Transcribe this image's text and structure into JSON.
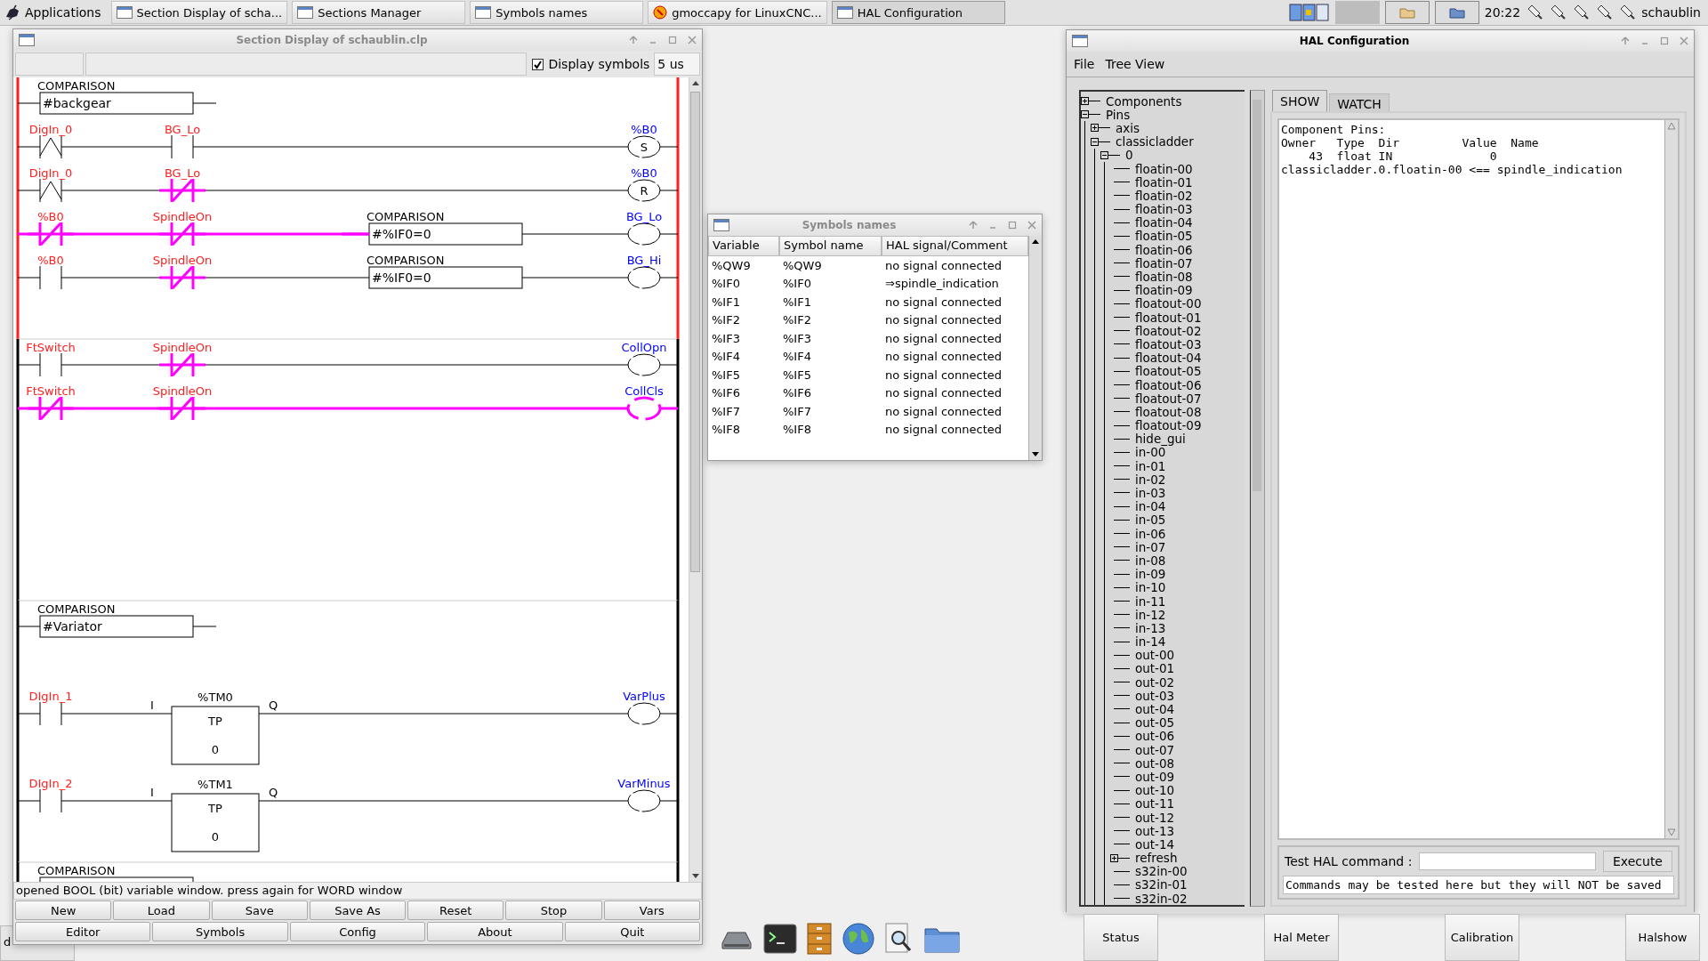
{
  "panel": {
    "menu_label": "Applications",
    "tasks": [
      {
        "label": "Section Display of scha...",
        "kind": "window",
        "selected": false
      },
      {
        "label": "Sections Manager",
        "kind": "window",
        "selected": false
      },
      {
        "label": "Symbols names",
        "kind": "window",
        "selected": false
      },
      {
        "label": "gmoccapy for LinuxCNC...",
        "kind": "app",
        "selected": false
      },
      {
        "label": "HAL Configuration",
        "kind": "window",
        "selected": true
      }
    ],
    "clock": "20:22",
    "user": "schaublin"
  },
  "section_window": {
    "title": "Section Display of schaublin.clp",
    "active": false,
    "display_symbols": {
      "label": "Display symbols",
      "checked": true
    },
    "period": "5 us",
    "blocks": [
      {
        "selected": true,
        "rows": [
          {
            "kind": "comparison",
            "label": "COMPARISON",
            "expression": "#backgear"
          },
          {
            "kind": "rung",
            "elements": [
              {
                "kind": "edge_contact",
                "label": "DigIn_0",
                "active": false
              },
              {
                "kind": "open_contact",
                "label": "BG_Lo",
                "active": false
              },
              {
                "kind": "coil",
                "label": "%B0",
                "letter": "S",
                "active": false
              }
            ]
          },
          {
            "kind": "rung",
            "elements": [
              {
                "kind": "edge_contact",
                "label": "DigIn_0",
                "active": false
              },
              {
                "kind": "closed_contact",
                "label": "BG_Lo",
                "active": true
              },
              {
                "kind": "coil",
                "label": "%B0",
                "letter": "R",
                "active": false
              }
            ]
          },
          {
            "kind": "rung",
            "elements": [
              {
                "kind": "closed_contact",
                "label": "%B0",
                "active": true
              },
              {
                "kind": "closed_contact",
                "label": "SpindleOn",
                "active": true
              },
              {
                "kind": "comparison",
                "label": "COMPARISON",
                "expression": "#%IF0=0",
                "active": true
              },
              {
                "kind": "coil",
                "label": "BG_Lo",
                "active": false
              }
            ]
          },
          {
            "kind": "rung",
            "elements": [
              {
                "kind": "open_contact",
                "label": "%B0",
                "active": false
              },
              {
                "kind": "closed_contact",
                "label": "SpindleOn",
                "active": true
              },
              {
                "kind": "comparison",
                "label": "COMPARISON",
                "expression": "#%IF0=0",
                "active": false
              },
              {
                "kind": "coil",
                "label": "BG_Hi",
                "active": false
              }
            ]
          }
        ]
      },
      {
        "selected": false,
        "rows": [
          {
            "kind": "rung",
            "elements": [
              {
                "kind": "open_contact",
                "label": "FtSwitch",
                "active": false
              },
              {
                "kind": "closed_contact",
                "label": "SpindleOn",
                "active": true
              },
              {
                "kind": "coil",
                "label": "CollOpn",
                "active": false
              }
            ]
          },
          {
            "kind": "rung",
            "elements": [
              {
                "kind": "closed_contact",
                "label": "FtSwitch",
                "active": true
              },
              {
                "kind": "closed_contact",
                "label": "SpindleOn",
                "active": true
              },
              {
                "kind": "coil",
                "label": "CollCls",
                "active": true
              }
            ]
          }
        ]
      },
      {
        "selected": false,
        "rows": [
          {
            "kind": "comparison",
            "label": "COMPARISON",
            "expression": "#Variator"
          },
          {
            "kind": "rung",
            "elements": [
              {
                "kind": "open_contact",
                "label": "DIgIn_1",
                "active": false
              },
              {
                "kind": "timer",
                "name": "%TM0",
                "mode": "TP",
                "preset": "0",
                "input": "I",
                "output": "Q"
              },
              {
                "kind": "coil",
                "label": "VarPlus",
                "active": false
              }
            ]
          },
          {
            "kind": "rung",
            "elements": [
              {
                "kind": "open_contact",
                "label": "DIgIn_2",
                "active": false
              },
              {
                "kind": "timer",
                "name": "%TM1",
                "mode": "TP",
                "preset": "0",
                "input": "I",
                "output": "Q"
              },
              {
                "kind": "coil",
                "label": "VarMinus",
                "active": false
              }
            ]
          }
        ]
      },
      {
        "selected": false,
        "rows": [
          {
            "kind": "comparison",
            "label": "COMPARISON"
          }
        ]
      }
    ],
    "status": "opened BOOL (bit) variable window. press again for WORD window",
    "buttons_row1": [
      "New",
      "Load",
      "Save",
      "Save As",
      "Reset",
      "Stop",
      "Vars"
    ],
    "buttons_row2": [
      "Editor",
      "Symbols",
      "Config",
      "About",
      "Quit"
    ]
  },
  "symbols_window": {
    "title": "Symbols names",
    "active": false,
    "columns": [
      "Variable",
      "Symbol name",
      "HAL signal/Comment"
    ],
    "rows": [
      [
        "%QW9",
        "%QW9",
        "no signal connected"
      ],
      [
        "%IF0",
        "%IF0",
        "⇒spindle_indication"
      ],
      [
        "%IF1",
        "%IF1",
        "no signal connected"
      ],
      [
        "%IF2",
        "%IF2",
        "no signal connected"
      ],
      [
        "%IF3",
        "%IF3",
        "no signal connected"
      ],
      [
        "%IF4",
        "%IF4",
        "no signal connected"
      ],
      [
        "%IF5",
        "%IF5",
        "no signal connected"
      ],
      [
        "%IF6",
        "%IF6",
        "no signal connected"
      ],
      [
        "%IF7",
        "%IF7",
        "no signal connected"
      ],
      [
        "%IF8",
        "%IF8",
        "no signal connected"
      ]
    ]
  },
  "hal_window": {
    "title": "HAL Configuration",
    "active": true,
    "menu": [
      "File",
      "Tree View"
    ],
    "tree": [
      {
        "label": "Components",
        "expanded": false
      },
      {
        "label": "Pins",
        "expanded": true,
        "children": [
          {
            "label": "axis",
            "expanded": false
          },
          {
            "label": "classicladder",
            "expanded": true,
            "children": [
              {
                "label": "0",
                "expanded": true,
                "children": [
                  {
                    "label": "floatin-00"
                  },
                  {
                    "label": "floatin-01"
                  },
                  {
                    "label": "floatin-02"
                  },
                  {
                    "label": "floatin-03"
                  },
                  {
                    "label": "floatin-04"
                  },
                  {
                    "label": "floatin-05"
                  },
                  {
                    "label": "floatin-06"
                  },
                  {
                    "label": "floatin-07"
                  },
                  {
                    "label": "floatin-08"
                  },
                  {
                    "label": "floatin-09"
                  },
                  {
                    "label": "floatout-00"
                  },
                  {
                    "label": "floatout-01"
                  },
                  {
                    "label": "floatout-02"
                  },
                  {
                    "label": "floatout-03"
                  },
                  {
                    "label": "floatout-04"
                  },
                  {
                    "label": "floatout-05"
                  },
                  {
                    "label": "floatout-06"
                  },
                  {
                    "label": "floatout-07"
                  },
                  {
                    "label": "floatout-08"
                  },
                  {
                    "label": "floatout-09"
                  },
                  {
                    "label": "hide_gui"
                  },
                  {
                    "label": "in-00"
                  },
                  {
                    "label": "in-01"
                  },
                  {
                    "label": "in-02"
                  },
                  {
                    "label": "in-03"
                  },
                  {
                    "label": "in-04"
                  },
                  {
                    "label": "in-05"
                  },
                  {
                    "label": "in-06"
                  },
                  {
                    "label": "in-07"
                  },
                  {
                    "label": "in-08"
                  },
                  {
                    "label": "in-09"
                  },
                  {
                    "label": "in-10"
                  },
                  {
                    "label": "in-11"
                  },
                  {
                    "label": "in-12"
                  },
                  {
                    "label": "in-13"
                  },
                  {
                    "label": "in-14"
                  },
                  {
                    "label": "out-00"
                  },
                  {
                    "label": "out-01"
                  },
                  {
                    "label": "out-02"
                  },
                  {
                    "label": "out-03"
                  },
                  {
                    "label": "out-04"
                  },
                  {
                    "label": "out-05"
                  },
                  {
                    "label": "out-06"
                  },
                  {
                    "label": "out-07"
                  },
                  {
                    "label": "out-08"
                  },
                  {
                    "label": "out-09"
                  },
                  {
                    "label": "out-10"
                  },
                  {
                    "label": "out-11"
                  },
                  {
                    "label": "out-12"
                  },
                  {
                    "label": "out-13"
                  },
                  {
                    "label": "out-14"
                  },
                  {
                    "label": "refresh",
                    "expanded": false
                  },
                  {
                    "label": "s32in-00"
                  },
                  {
                    "label": "s32in-01"
                  },
                  {
                    "label": "s32in-02"
                  }
                ]
              }
            ]
          }
        ]
      }
    ],
    "tabs": [
      {
        "label": "SHOW",
        "selected": true
      },
      {
        "label": "WATCH",
        "selected": false
      }
    ],
    "output_lines": [
      "Component Pins:",
      "Owner   Type  Dir         Value  Name",
      "    43  float IN              0",
      "classicladder.0.floatin-00 <== spindle_indication"
    ],
    "command_label": "Test HAL command :",
    "execute_label": "Execute",
    "note": "Commands may be tested here but they will NOT be saved"
  },
  "background_buttons": [
    "Status",
    "Hal Meter",
    "Calibration",
    "Halshow"
  ],
  "background_text": "d"
}
